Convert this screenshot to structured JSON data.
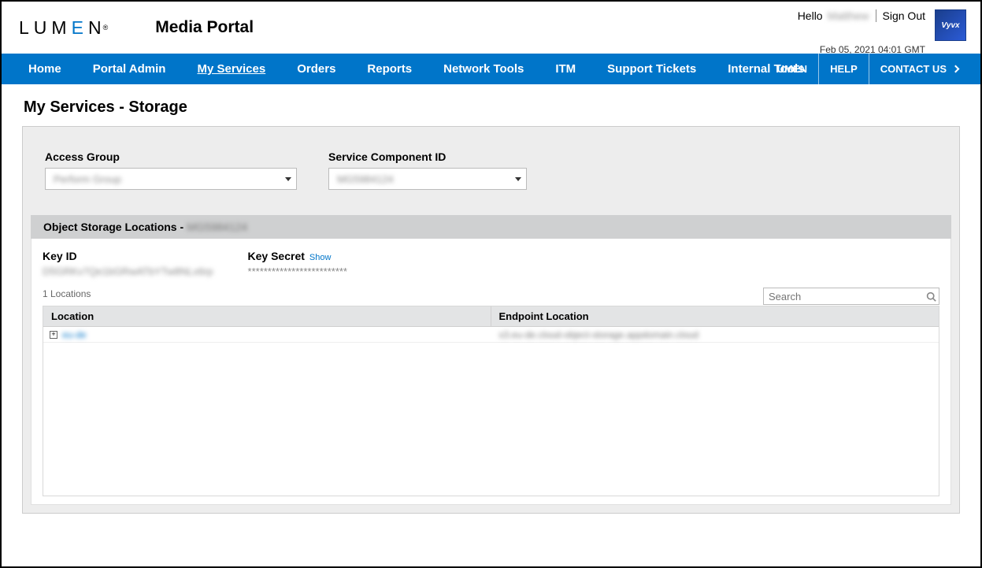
{
  "header": {
    "logo_text_parts": [
      "L",
      "U",
      "M",
      "E",
      "N",
      "®"
    ],
    "portal_title": "Media Portal",
    "greeting_prefix": "Hello",
    "greeting_name_masked": "Matthew",
    "sign_out": "Sign Out",
    "timestamp": "Feb 05, 2021 04:01 GMT",
    "vyvx_label": "Vyvx"
  },
  "nav": {
    "items": [
      "Home",
      "Portal Admin",
      "My Services",
      "Orders",
      "Reports",
      "Network Tools",
      "ITM",
      "Support Tickets",
      "Internal Tools"
    ],
    "active_index": 2,
    "right": {
      "umen": "UMEN",
      "help": "HELP",
      "contact": "CONTACT US"
    }
  },
  "page": {
    "title": "My Services - Storage",
    "access_group_label": "Access Group",
    "access_group_value_masked": "Perform Group",
    "service_component_label": "Service Component ID",
    "service_component_value_masked": "MG5984124"
  },
  "storage": {
    "panel_title_prefix": "Object Storage Locations - ",
    "panel_title_id_masked": "MG5984124",
    "key_id_label": "Key ID",
    "key_id_value_masked": "D5GRKv7Qe1bGRwATbYTw8NLx6rp",
    "key_secret_label": "Key Secret",
    "show_link": "Show",
    "key_secret_value": "*************************",
    "locations_count": "1 Locations",
    "search_placeholder": "Search",
    "columns": {
      "location": "Location",
      "endpoint": "Endpoint Location"
    },
    "rows": [
      {
        "location_masked": "eu-de",
        "endpoint_masked": "s3.eu-de.cloud-object-storage.appdomain.cloud"
      }
    ]
  }
}
